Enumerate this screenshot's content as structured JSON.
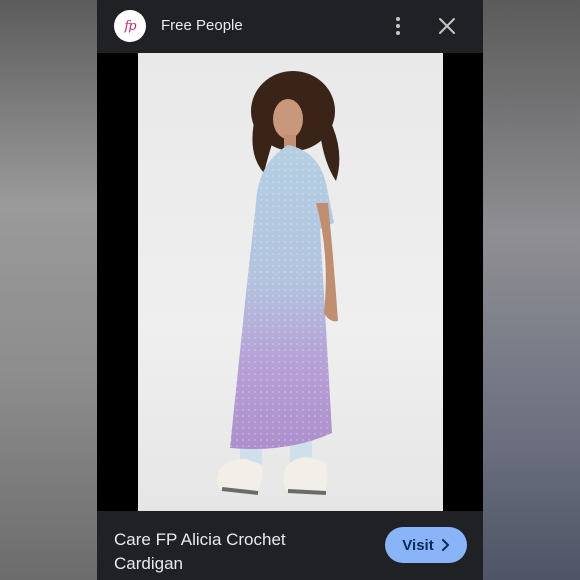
{
  "header": {
    "logo_text": "fp",
    "site_name": "Free People",
    "more_icon": "more-vert-icon",
    "close_icon": "close-icon"
  },
  "product": {
    "title": "Care FP Alicia Crochet Cardigan",
    "visit_label": "Visit",
    "visit_icon": "chevron-right-icon"
  },
  "colors": {
    "sheet_bg": "#202124",
    "accent": "#8ab4f8",
    "logo_pink": "#c0267a",
    "cardigan_top": "#b3cde0",
    "cardigan_bottom": "#b89ad1"
  }
}
